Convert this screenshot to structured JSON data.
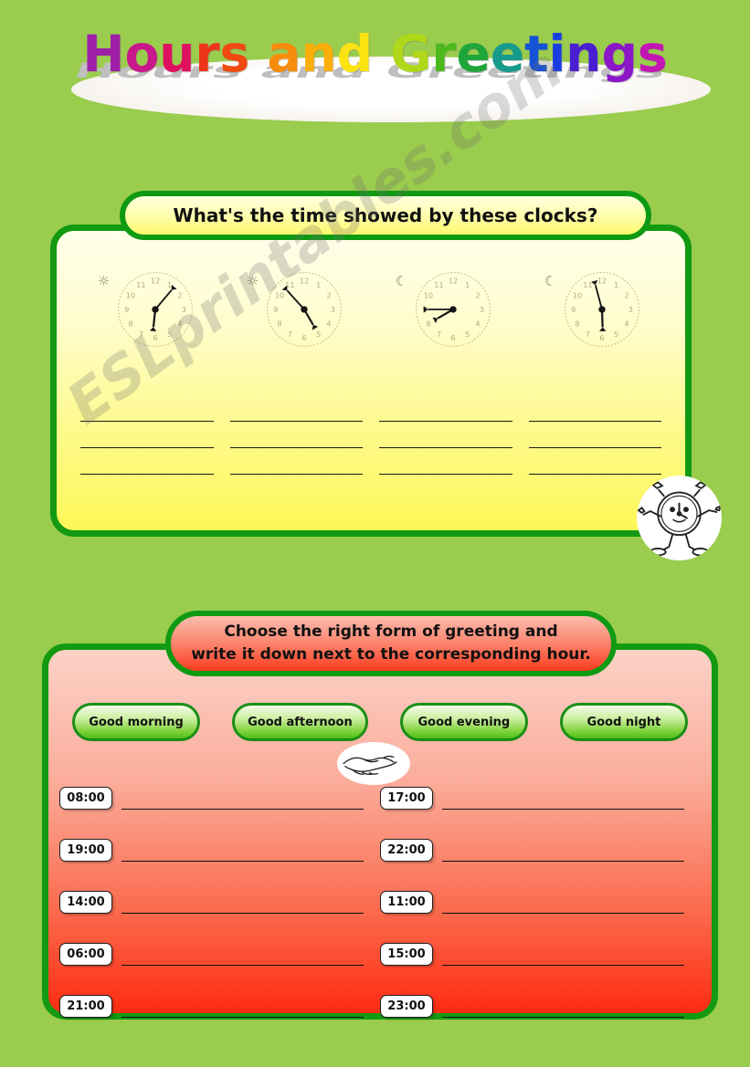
{
  "title": {
    "text": "Hours and Greetings",
    "letters": [
      {
        "ch": "H",
        "color": "#A01FA8"
      },
      {
        "ch": "o",
        "color": "#C9178C"
      },
      {
        "ch": "u",
        "color": "#E01060"
      },
      {
        "ch": "r",
        "color": "#EE3418"
      },
      {
        "ch": "s",
        "color": "#F04A10"
      },
      {
        "ch": " ",
        "color": "#FFFFFF"
      },
      {
        "ch": "a",
        "color": "#F78C0A"
      },
      {
        "ch": "n",
        "color": "#FBAE08"
      },
      {
        "ch": "d",
        "color": "#FBE312"
      },
      {
        "ch": " ",
        "color": "#FFFFFF"
      },
      {
        "ch": "G",
        "color": "#AFD918"
      },
      {
        "ch": "r",
        "color": "#4CB81C"
      },
      {
        "ch": "e",
        "color": "#1FA63B"
      },
      {
        "ch": "e",
        "color": "#169A8C"
      },
      {
        "ch": "t",
        "color": "#1452D6"
      },
      {
        "ch": "i",
        "color": "#1A3DE0"
      },
      {
        "ch": "n",
        "color": "#4A1FD2"
      },
      {
        "ch": "g",
        "color": "#8B17C8"
      },
      {
        "ch": "s",
        "color": "#C215B4"
      }
    ]
  },
  "watermark": "ESLprintables.com",
  "exercise1": {
    "heading": "What's the time showed by these clocks?",
    "clocks": [
      {
        "id": "clock-1",
        "daynight": "sun",
        "daynight_glyph": "☼",
        "hour_angle": 186,
        "minute_angle": 40
      },
      {
        "id": "clock-2",
        "daynight": "sun",
        "daynight_glyph": "☼",
        "hour_angle": 150,
        "minute_angle": 318
      },
      {
        "id": "clock-3",
        "daynight": "moon",
        "daynight_glyph": "☾",
        "hour_angle": 240,
        "minute_angle": 270
      },
      {
        "id": "clock-4",
        "daynight": "moon",
        "daynight_glyph": "☾",
        "hour_angle": 178,
        "minute_angle": 345
      }
    ],
    "answer_columns": 4,
    "answer_lines_per_column": 3
  },
  "exercise2": {
    "heading_line1": "Choose the right form of greeting and",
    "heading_line2": "write it down next to the corresponding hour.",
    "options": [
      {
        "label": "Good morning"
      },
      {
        "label": "Good afternoon"
      },
      {
        "label": "Good evening"
      },
      {
        "label": "Good night"
      }
    ],
    "times_left": [
      "08:00",
      "19:00",
      "14:00",
      "06:00",
      "21:00"
    ],
    "times_right": [
      "17:00",
      "22:00",
      "11:00",
      "15:00",
      "23:00"
    ]
  },
  "decorations": {
    "mascot": "alarm-clock-character",
    "handshake": "handshake-drawing"
  },
  "colors": {
    "page_background": "#9ACC4E",
    "border_green": "#139A12",
    "panel_yellow_top": "#FFFFEB",
    "panel_yellow_bottom": "#FDF757",
    "panel_red_top": "#FBD2C6",
    "panel_red_bottom": "#FD2C12"
  }
}
